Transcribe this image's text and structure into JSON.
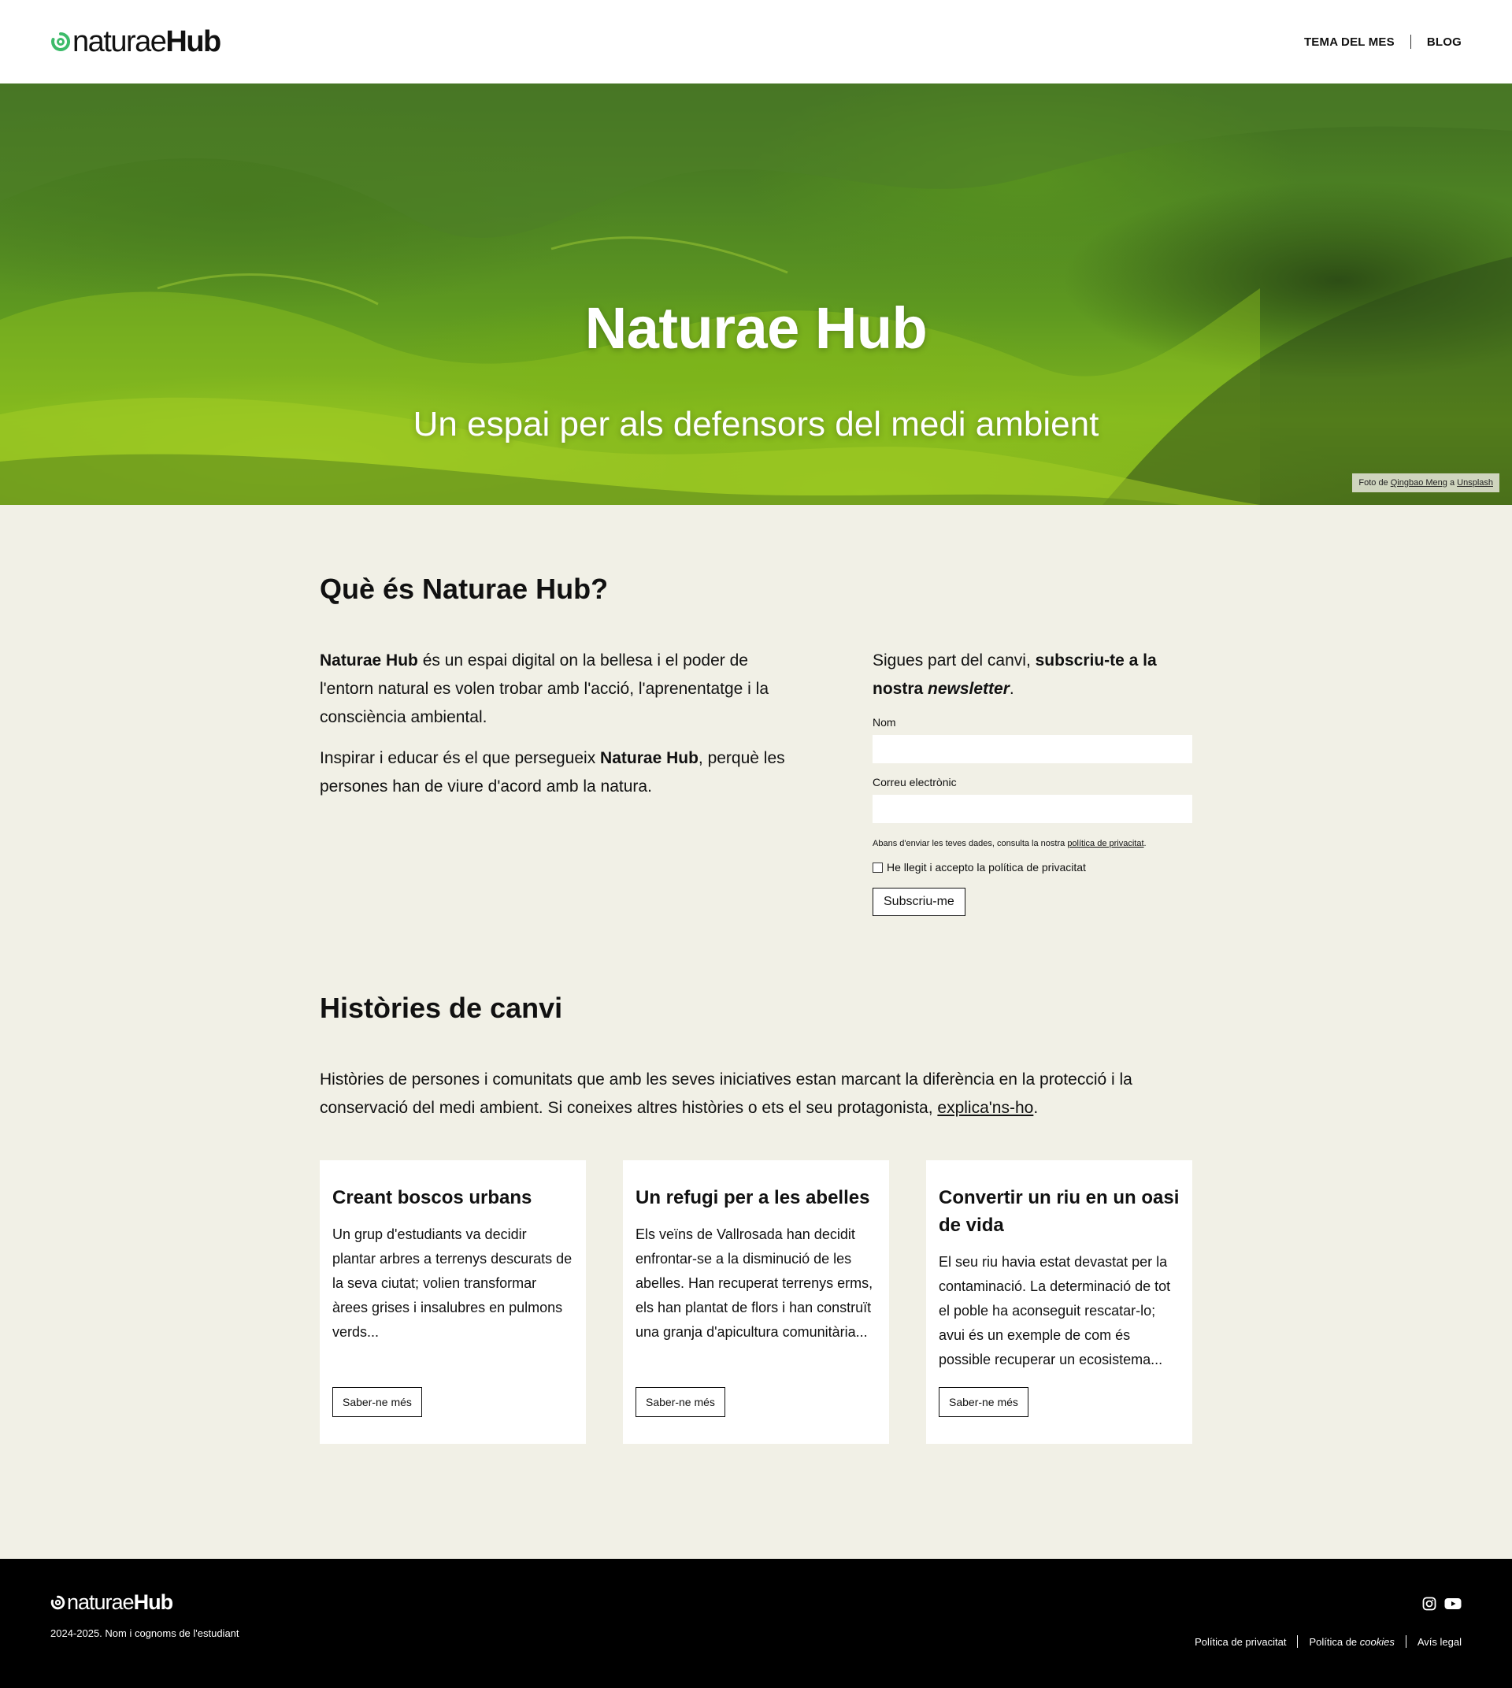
{
  "header": {
    "logo_light": "naturae",
    "logo_bold": "Hub",
    "nav": [
      {
        "label": "TEMA DEL MES"
      },
      {
        "label": "BLOG"
      }
    ]
  },
  "hero": {
    "title": "Naturae Hub",
    "subtitle": "Un espai per als defensors del medi ambient",
    "credit_prefix": "Foto de ",
    "credit_author": "Qingbao Meng",
    "credit_mid": " a ",
    "credit_source": "Unsplash"
  },
  "about": {
    "title": "Què és Naturae Hub?",
    "p1_bold": "Naturae Hub",
    "p1_rest": " és un espai digital on la bellesa i el poder de l'entorn natural es volen trobar amb l'acció, l'aprenentatge i la consciència ambiental.",
    "p2_start": "Inspirar i educar és el que persegueix ",
    "p2_bold": "Naturae Hub",
    "p2_rest": ", perquè les persones han de viure d'acord amb la natura."
  },
  "newsletter": {
    "intro_start": "Sigues part del canvi, ",
    "intro_bold": "subscriu-te a la nostra ",
    "intro_italic": "newsletter",
    "intro_end": ".",
    "name_label": "Nom",
    "email_label": "Correu electrònic",
    "note_start": "Abans d'enviar les teves dades, consulta la nostra ",
    "note_link": "política de privacitat",
    "note_end": ".",
    "checkbox_label": "He llegit i accepto la política de privacitat",
    "submit_label": "Subscriu-me"
  },
  "stories": {
    "title": "Històries de canvi",
    "intro_start": "Històries de persones i comunitats que amb les seves iniciatives estan marcant la diferència en la protecció i la conservació del medi ambient. Si coneixes altres històries o ets el seu protagonista, ",
    "intro_link": "explica'ns-ho",
    "intro_end": ".",
    "cards": [
      {
        "title": "Creant boscos urbans",
        "text": "Un grup d'estudiants va decidir plantar arbres a terrenys descurats de la seva ciutat; volien transformar àrees grises i insalubres en pulmons verds...",
        "button": "Saber-ne més"
      },
      {
        "title": "Un refugi per a les abelles",
        "text": "Els veïns de Vallrosada han decidit enfrontar-se a la disminució de les abelles. Han recuperat terrenys erms, els han plantat de flors i han construït una granja d'apicultura comunitària...",
        "button": "Saber-ne més"
      },
      {
        "title": "Convertir un riu en un oasi de vida",
        "text": "El seu riu havia estat devastat per la contaminació. La determinació de tot el poble ha aconseguit rescatar-lo; avui és un exemple de com és possible recuperar un ecosistema...",
        "button": "Saber-ne més"
      }
    ]
  },
  "footer": {
    "logo_light": "naturae",
    "logo_bold": "Hub",
    "copyright": "2024-2025. Nom i cognoms de l'estudiant",
    "social": [
      "instagram-icon",
      "youtube-icon"
    ],
    "legal_privacy": "Política de privacitat",
    "legal_cookies_start": "Política de ",
    "legal_cookies_italic": "cookies",
    "legal_notice": "Avís legal"
  },
  "colors": {
    "brand_green": "#3dbb6a",
    "page_bg": "#f1f0e6",
    "footer_bg": "#000000"
  }
}
